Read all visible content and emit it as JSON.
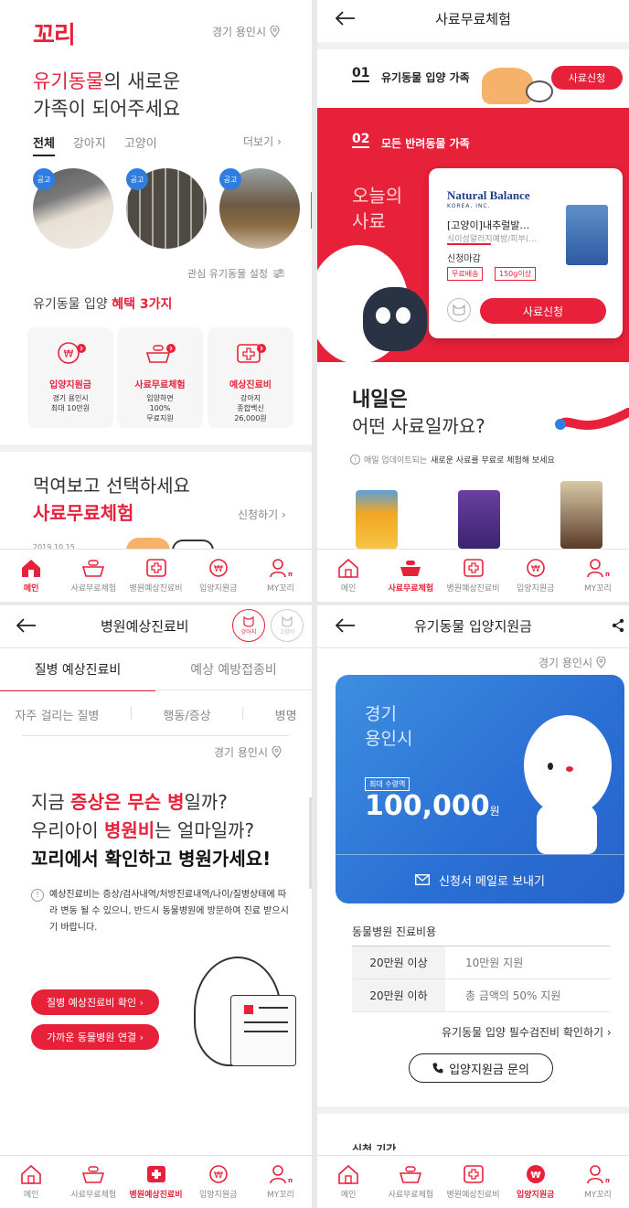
{
  "p1": {
    "logo": "꼬리",
    "location": "경기 용인시",
    "headline_red": "유기동물",
    "headline_rest": "의 새로운",
    "headline_line2": "가족이 되어주세요",
    "filters": [
      "전체",
      "강아지",
      "고양이"
    ],
    "more": "더보기",
    "badge": "공고",
    "interest": "관심 유기동물 설정",
    "benefit_prefix": "유기동물 입양 ",
    "benefit_red": "혜택 3가지",
    "cards": [
      {
        "title": "입양지원금",
        "l1": "경기 용인시",
        "l2": "최대 10만원",
        "l3": ""
      },
      {
        "title": "사료무료체험",
        "l1": "입양하면",
        "l2": "100%",
        "l3": "무료지원"
      },
      {
        "title": "예상진료비",
        "l1": "강아지",
        "l2": "종합백신",
        "l3": "26,000원"
      }
    ],
    "sec2_l1": "먹여보고 선택하세요",
    "sec2_l2": "사료무료체험",
    "apply": "신청하기",
    "date": "2019.10.15"
  },
  "tabs": [
    {
      "label": "메인",
      "icon": "home-icon"
    },
    {
      "label": "사료무료체험",
      "icon": "food-bowl-icon"
    },
    {
      "label": "병원예상진료비",
      "icon": "hospital-cross-icon"
    },
    {
      "label": "입양지원금",
      "icon": "won-coin-icon"
    },
    {
      "label": "MY꼬리",
      "icon": "my-person-icon"
    }
  ],
  "p2": {
    "title": "사료무료체험",
    "s1_num": "01",
    "s1_label": "유기동물 입양 가족",
    "s1_btn": "사료신청",
    "s2_num": "02",
    "s2_label": "모든 반려동물 가족",
    "today_l1": "오늘의",
    "today_l2": "사료",
    "brand": "Natural Balance",
    "brand_sub": "KOREA, INC.",
    "product": "[고양이]내추럴발…",
    "desc": "식이성알러지예방/피부(…",
    "status": "신청마감",
    "tag1": "무료배송",
    "tag2": "150g이상",
    "card_btn": "사료신청",
    "tom_l1": "내일은",
    "tom_l2": "어떤 사료일까요?",
    "note_gray": "매일 업데이트되는 ",
    "note_bold": "새로운 사료를 무료로 체험해 보세요"
  },
  "p3": {
    "title": "병원예상진료비",
    "toggle1": "강아지",
    "toggle2": "고양이",
    "tab1": "질병 예상진료비",
    "tab2": "예상 예방접종비",
    "sub1": "자주 걸리는 질병",
    "sub2": "행동/증상",
    "sub3": "병명",
    "location": "경기 용인시",
    "h1a": "지금 ",
    "h1b": "증상은 무슨 병",
    "h1c": "일까?",
    "h2a": "우리아이 ",
    "h2b": "병원비",
    "h2c": "는 얼마일까?",
    "h3": "꼬리에서 확인하고 병원가세요!",
    "notice": "예상진료비는 증상/검사내역/처방진료내역/나이/질병상태에 따라 변동 될 수 있으니, 반드시 동물병원에 방문하여 진료 받으시기 바랍니다.",
    "btn1": "질병 예상진료비 확인",
    "btn2": "가까운 동물병원 연결"
  },
  "p4": {
    "title": "유기동물 입양지원금",
    "location": "경기 용인시",
    "city_l1": "경기",
    "city_l2": "용인시",
    "max_label": "최대 수령액",
    "amount": "100,000",
    "unit": "원",
    "mail": "신청서 메일로 보내기",
    "table_title": "동물병원 진료비용",
    "rows": [
      {
        "k": "20만원 이상",
        "v": "10만원 지원"
      },
      {
        "k": "20만원 이하",
        "v": "총 금액의 50% 지원"
      }
    ],
    "check_link": "유기동물 입양 필수검진비 확인하기",
    "inquiry": "입양지원금 문의",
    "next": "신청 기간"
  },
  "colors": {
    "brand_red": "#e8213a",
    "blue": "#2f7de1"
  }
}
